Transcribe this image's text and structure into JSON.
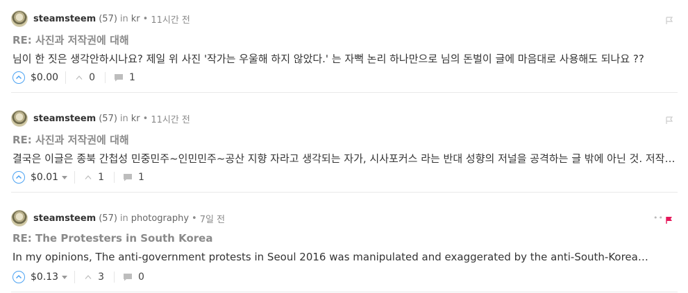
{
  "comments": [
    {
      "author": "steamsteem",
      "reputation": "(57)",
      "in_label": "in",
      "category": "kr",
      "separator": "•",
      "time": "11시간 전",
      "title": "RE: 사진과 저작권에 대해",
      "body": "님이 한 짓은 생각안하시나요? 제일 위 사진 '작가는 우울해 하지 않았다.' 는 자뻑 논리 하나만으로 님의 돈벌이 글에 마음대로 사용해도 되나요 ??",
      "payout": "$0.00",
      "votes": "0",
      "replies": "1",
      "flag_color": "#cccccc"
    },
    {
      "author": "steamsteem",
      "reputation": "(57)",
      "in_label": "in",
      "category": "kr",
      "separator": "•",
      "time": "11시간 전",
      "title": "RE: 사진과 저작권에 대해",
      "body": "결국은 이글은 종북 간첩성 민중민주~인민민주~공산 지향 자라고 생각되는 자가, 시사포커스 라는 반대 성향의 저널을 공격하는 글 밖에 아닌 것. 저작권을 이유로 이런 글을 쓰는 것 자체가 문제입니다.",
      "payout": "$0.01",
      "votes": "1",
      "replies": "1",
      "flag_color": "#cccccc"
    },
    {
      "author": "steamsteem",
      "reputation": "(57)",
      "in_label": "in",
      "category": "photography",
      "separator": "•",
      "time": "7일 전",
      "title": "RE: The Protesters in South Korea",
      "body": "In my opinions, The anti-government protests in Seoul 2016 was manipulated and exaggerated by the anti-South-Korea…",
      "payout": "$0.13",
      "votes": "3",
      "replies": "0",
      "flag_color": "#e5175a"
    }
  ],
  "colors": {
    "upvote_ring": "#4ba2f2",
    "flag_active": "#e5175a",
    "muted_text": "#8a8a8a"
  },
  "icons": [
    "avatar",
    "upvote-circle-icon",
    "chevron-up-icon",
    "comment-bubble-icon",
    "flag-icon",
    "caret-down-icon"
  ]
}
